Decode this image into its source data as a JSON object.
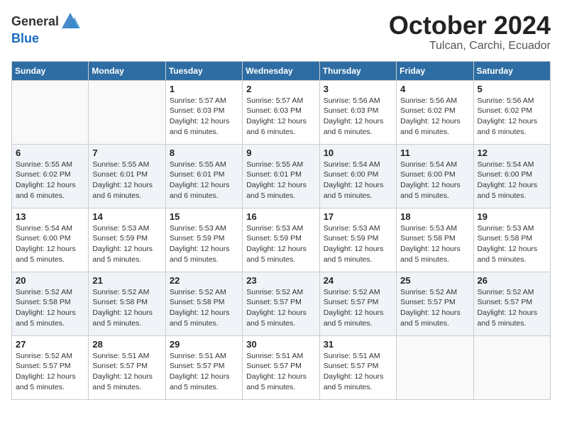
{
  "header": {
    "logo_general": "General",
    "logo_blue": "Blue",
    "month": "October 2024",
    "location": "Tulcan, Carchi, Ecuador"
  },
  "weekdays": [
    "Sunday",
    "Monday",
    "Tuesday",
    "Wednesday",
    "Thursday",
    "Friday",
    "Saturday"
  ],
  "weeks": [
    [
      {
        "day": "",
        "info": ""
      },
      {
        "day": "",
        "info": ""
      },
      {
        "day": "1",
        "info": "Sunrise: 5:57 AM\nSunset: 6:03 PM\nDaylight: 12 hours\nand 6 minutes."
      },
      {
        "day": "2",
        "info": "Sunrise: 5:57 AM\nSunset: 6:03 PM\nDaylight: 12 hours\nand 6 minutes."
      },
      {
        "day": "3",
        "info": "Sunrise: 5:56 AM\nSunset: 6:03 PM\nDaylight: 12 hours\nand 6 minutes."
      },
      {
        "day": "4",
        "info": "Sunrise: 5:56 AM\nSunset: 6:02 PM\nDaylight: 12 hours\nand 6 minutes."
      },
      {
        "day": "5",
        "info": "Sunrise: 5:56 AM\nSunset: 6:02 PM\nDaylight: 12 hours\nand 6 minutes."
      }
    ],
    [
      {
        "day": "6",
        "info": "Sunrise: 5:55 AM\nSunset: 6:02 PM\nDaylight: 12 hours\nand 6 minutes."
      },
      {
        "day": "7",
        "info": "Sunrise: 5:55 AM\nSunset: 6:01 PM\nDaylight: 12 hours\nand 6 minutes."
      },
      {
        "day": "8",
        "info": "Sunrise: 5:55 AM\nSunset: 6:01 PM\nDaylight: 12 hours\nand 6 minutes."
      },
      {
        "day": "9",
        "info": "Sunrise: 5:55 AM\nSunset: 6:01 PM\nDaylight: 12 hours\nand 5 minutes."
      },
      {
        "day": "10",
        "info": "Sunrise: 5:54 AM\nSunset: 6:00 PM\nDaylight: 12 hours\nand 5 minutes."
      },
      {
        "day": "11",
        "info": "Sunrise: 5:54 AM\nSunset: 6:00 PM\nDaylight: 12 hours\nand 5 minutes."
      },
      {
        "day": "12",
        "info": "Sunrise: 5:54 AM\nSunset: 6:00 PM\nDaylight: 12 hours\nand 5 minutes."
      }
    ],
    [
      {
        "day": "13",
        "info": "Sunrise: 5:54 AM\nSunset: 6:00 PM\nDaylight: 12 hours\nand 5 minutes."
      },
      {
        "day": "14",
        "info": "Sunrise: 5:53 AM\nSunset: 5:59 PM\nDaylight: 12 hours\nand 5 minutes."
      },
      {
        "day": "15",
        "info": "Sunrise: 5:53 AM\nSunset: 5:59 PM\nDaylight: 12 hours\nand 5 minutes."
      },
      {
        "day": "16",
        "info": "Sunrise: 5:53 AM\nSunset: 5:59 PM\nDaylight: 12 hours\nand 5 minutes."
      },
      {
        "day": "17",
        "info": "Sunrise: 5:53 AM\nSunset: 5:59 PM\nDaylight: 12 hours\nand 5 minutes."
      },
      {
        "day": "18",
        "info": "Sunrise: 5:53 AM\nSunset: 5:58 PM\nDaylight: 12 hours\nand 5 minutes."
      },
      {
        "day": "19",
        "info": "Sunrise: 5:53 AM\nSunset: 5:58 PM\nDaylight: 12 hours\nand 5 minutes."
      }
    ],
    [
      {
        "day": "20",
        "info": "Sunrise: 5:52 AM\nSunset: 5:58 PM\nDaylight: 12 hours\nand 5 minutes."
      },
      {
        "day": "21",
        "info": "Sunrise: 5:52 AM\nSunset: 5:58 PM\nDaylight: 12 hours\nand 5 minutes."
      },
      {
        "day": "22",
        "info": "Sunrise: 5:52 AM\nSunset: 5:58 PM\nDaylight: 12 hours\nand 5 minutes."
      },
      {
        "day": "23",
        "info": "Sunrise: 5:52 AM\nSunset: 5:57 PM\nDaylight: 12 hours\nand 5 minutes."
      },
      {
        "day": "24",
        "info": "Sunrise: 5:52 AM\nSunset: 5:57 PM\nDaylight: 12 hours\nand 5 minutes."
      },
      {
        "day": "25",
        "info": "Sunrise: 5:52 AM\nSunset: 5:57 PM\nDaylight: 12 hours\nand 5 minutes."
      },
      {
        "day": "26",
        "info": "Sunrise: 5:52 AM\nSunset: 5:57 PM\nDaylight: 12 hours\nand 5 minutes."
      }
    ],
    [
      {
        "day": "27",
        "info": "Sunrise: 5:52 AM\nSunset: 5:57 PM\nDaylight: 12 hours\nand 5 minutes."
      },
      {
        "day": "28",
        "info": "Sunrise: 5:51 AM\nSunset: 5:57 PM\nDaylight: 12 hours\nand 5 minutes."
      },
      {
        "day": "29",
        "info": "Sunrise: 5:51 AM\nSunset: 5:57 PM\nDaylight: 12 hours\nand 5 minutes."
      },
      {
        "day": "30",
        "info": "Sunrise: 5:51 AM\nSunset: 5:57 PM\nDaylight: 12 hours\nand 5 minutes."
      },
      {
        "day": "31",
        "info": "Sunrise: 5:51 AM\nSunset: 5:57 PM\nDaylight: 12 hours\nand 5 minutes."
      },
      {
        "day": "",
        "info": ""
      },
      {
        "day": "",
        "info": ""
      }
    ]
  ]
}
